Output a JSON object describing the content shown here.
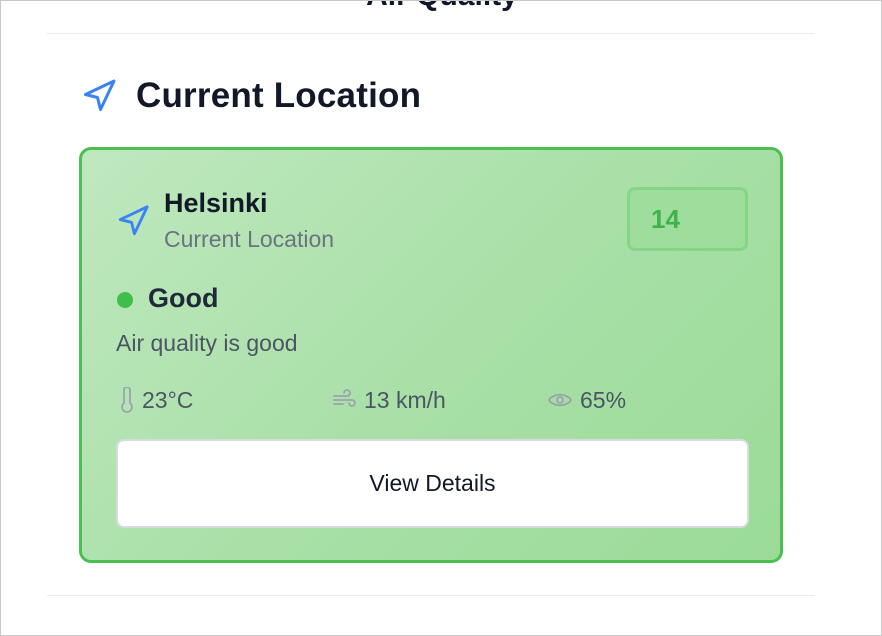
{
  "page": {
    "top_title": "Air Quality",
    "section_title": "Current Location",
    "section_icon": "navigation-arrow-icon"
  },
  "card": {
    "city": "Helsinki",
    "location_label": "Current Location",
    "location_icon": "navigation-arrow-icon",
    "aqi": "14",
    "status": "Good",
    "status_color": "#3fbf4a",
    "description": "Air quality is good",
    "metrics": [
      {
        "icon": "thermometer-icon",
        "value": "23°C"
      },
      {
        "icon": "wind-icon",
        "value": "13 km/h"
      },
      {
        "icon": "eye-icon",
        "value": "65%"
      }
    ],
    "button_label": "View Details"
  },
  "colors": {
    "accent_blue": "#3b82f6",
    "card_border": "#4cbf52",
    "aqi_text": "#3fb34a"
  }
}
